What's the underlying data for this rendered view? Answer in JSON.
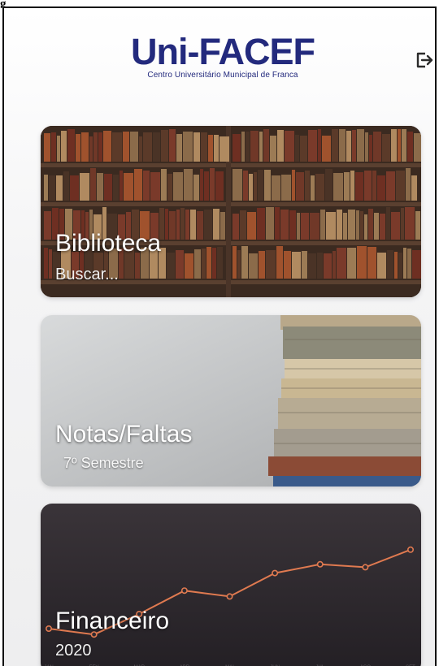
{
  "header": {
    "caption": "g",
    "logo_text": "Uni-FACEF",
    "logo_subtitle": "Centro Universitário Municipal de Franca",
    "logout_icon": "logout-icon"
  },
  "cards": [
    {
      "title": "Biblioteca",
      "subtitle": "Buscar...",
      "image": "bookshelf"
    },
    {
      "title": "Notas/Faltas",
      "subtitle": "7º Semestre",
      "image": "book-stack"
    },
    {
      "title": "Financeiro",
      "subtitle": "2020",
      "image": "line-chart"
    }
  ],
  "colors": {
    "brand": "#232a7d",
    "chart_line": "#e07a50",
    "chart_bg": "#2f2a30"
  },
  "chart_data": {
    "type": "line",
    "x": [
      "JAN",
      "FEV",
      "MAR",
      "ABR",
      "MAI",
      "JUN",
      "JUL",
      "AGO",
      "SET"
    ],
    "series": [
      {
        "values": [
          2.0,
          1.6,
          3.0,
          4.6,
          4.2,
          5.8,
          6.4,
          6.2,
          7.4
        ]
      }
    ],
    "ylim": [
      0,
      10
    ],
    "grid": false
  }
}
